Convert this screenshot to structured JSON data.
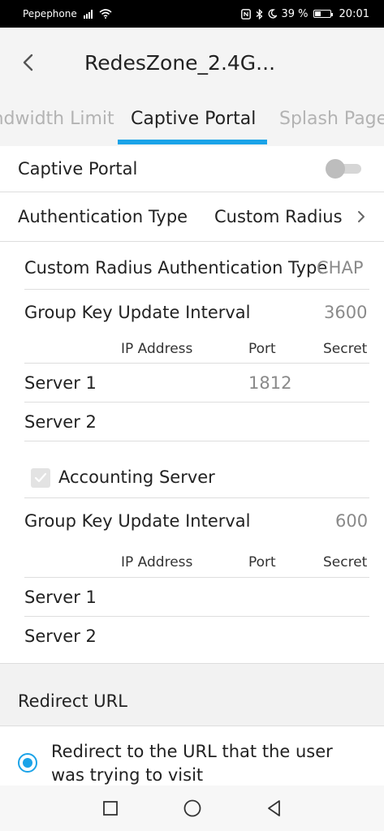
{
  "status_bar": {
    "carrier": "Pepephone",
    "battery_percent": "39 %",
    "time": "20:01",
    "icons": [
      "signal-icon",
      "wifi-icon",
      "nfc-icon",
      "bluetooth-icon",
      "moon-icon",
      "battery-icon"
    ]
  },
  "app_bar": {
    "title": "RedesZone_2.4G...",
    "back_icon": "chevron-left-icon"
  },
  "tabs": [
    {
      "label": "Bandwidth Limit",
      "active": false
    },
    {
      "label": "Captive Portal",
      "active": true
    },
    {
      "label": "Splash Page",
      "active": false
    }
  ],
  "accent_color": "#1ba3e8",
  "captive_portal": {
    "label": "Captive Portal",
    "enabled": false
  },
  "auth_type": {
    "label": "Authentication Type",
    "value": "Custom Radius"
  },
  "radius": {
    "auth_type_label": "Custom Radius Authentication Type",
    "auth_type_value": "CHAP",
    "group_key_label": "Group Key Update Interval",
    "group_key_value": "3600",
    "headers": {
      "ip": "IP Address",
      "port": "Port",
      "secret": "Secret"
    },
    "servers": [
      {
        "label": "Server 1",
        "port": "1812"
      },
      {
        "label": "Server 2",
        "port": ""
      }
    ]
  },
  "accounting": {
    "label": "Accounting Server",
    "checked": true,
    "group_key_label": "Group Key Update Interval",
    "group_key_value": "600",
    "headers": {
      "ip": "IP Address",
      "port": "Port",
      "secret": "Secret"
    },
    "servers": [
      {
        "label": "Server 1"
      },
      {
        "label": "Server 2"
      }
    ]
  },
  "redirect": {
    "title": "Redirect URL",
    "option_line1": "Redirect to the URL that the user",
    "option_line2": "was trying to visit",
    "selected": true
  },
  "nav_bar": {
    "icons": [
      "recent-apps-icon",
      "home-icon",
      "back-triangle-icon"
    ]
  }
}
